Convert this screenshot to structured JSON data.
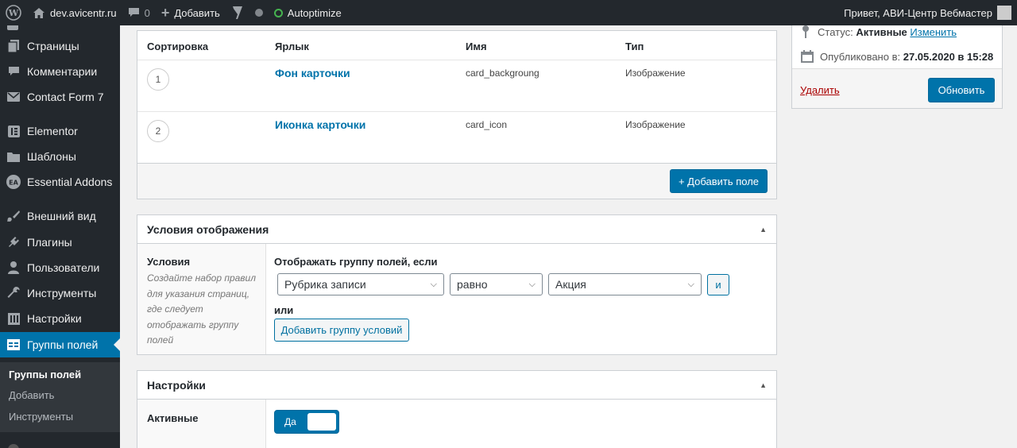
{
  "adminbar": {
    "site": "dev.avicentr.ru",
    "comments_count": "0",
    "add_new": "Добавить",
    "autoptimize": "Autoptimize",
    "greeting": "Привет, АВИ-Центр Вебмастер"
  },
  "sidebar": {
    "items": [
      {
        "label": "Страницы",
        "icon": "pages-icon"
      },
      {
        "label": "Комментарии",
        "icon": "comments-icon"
      },
      {
        "label": "Contact Form 7",
        "icon": "mail-icon"
      },
      {
        "label": "Elementor",
        "icon": "elementor-icon"
      },
      {
        "label": "Шаблоны",
        "icon": "folder-icon"
      },
      {
        "label": "Essential Addons",
        "icon": "essential-addons-icon"
      },
      {
        "label": "Внешний вид",
        "icon": "appearance-icon"
      },
      {
        "label": "Плагины",
        "icon": "plugins-icon"
      },
      {
        "label": "Пользователи",
        "icon": "users-icon"
      },
      {
        "label": "Инструменты",
        "icon": "tools-icon"
      },
      {
        "label": "Настройки",
        "icon": "settings-icon"
      },
      {
        "label": "Группы полей",
        "icon": "field-groups-icon"
      }
    ],
    "submenu": [
      "Группы полей",
      "Добавить",
      "Инструменты"
    ]
  },
  "fields_table": {
    "headers": [
      "Сортировка",
      "Ярлык",
      "Имя",
      "Тип"
    ],
    "rows": [
      {
        "order": "1",
        "label": "Фон карточки",
        "name": "card_backgroung",
        "type": "Изображение"
      },
      {
        "order": "2",
        "label": "Иконка карточки",
        "name": "card_icon",
        "type": "Изображение"
      }
    ],
    "add_button": "+ Добавить поле"
  },
  "conditions": {
    "title": "Условия отображения",
    "label": "Условия",
    "help": "Создайте набор правил для указания страниц, где следует отображать группу полей",
    "rule_heading": "Отображать группу полей, если",
    "param": "Рубрика записи",
    "operator": "равно",
    "value": "Акция",
    "and_button": "и",
    "or_label": "или",
    "add_group_button": "Добавить группу условий"
  },
  "settings": {
    "title": "Настройки",
    "active_label": "Активные",
    "active_toggle": "Да"
  },
  "publish": {
    "status_prefix": "Статус:",
    "status_value": "Активные",
    "status_edit": "Изменить",
    "published_prefix": "Опубликовано в:",
    "published_value": "27.05.2020 в 15:28",
    "delete": "Удалить",
    "update": "Обновить"
  }
}
